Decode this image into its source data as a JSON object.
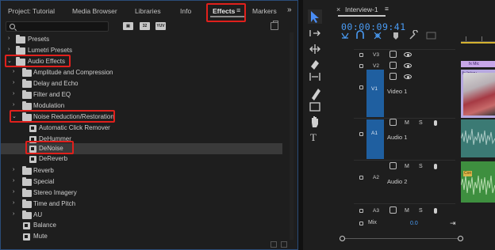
{
  "effects_panel": {
    "tabs": {
      "project": "Project: Tutorial",
      "media_browser": "Media Browser",
      "libraries": "Libraries",
      "info": "Info",
      "effects": "Effects",
      "markers": "Markers"
    },
    "menu_glyph": "≡",
    "overflow_glyph": "»",
    "search": {
      "placeholder": "",
      "value": ""
    },
    "badges": {
      "accelerated": "▣",
      "b32": "32",
      "yuv": "YUV"
    },
    "tree": {
      "presets": "Presets",
      "lumetri_presets": "Lumetri Presets",
      "audio_effects": "Audio Effects",
      "amplitude": "Amplitude and Compression",
      "delay": "Delay and Echo",
      "filter": "Filter and EQ",
      "modulation": "Modulation",
      "noise": "Noise Reduction/Restoration",
      "auto_click": "Automatic Click Remover",
      "dehummer": "DeHummer",
      "denoise": "DeNoise",
      "dereverb": "DeReverb",
      "reverb": "Reverb",
      "special": "Special",
      "stereo": "Stereo Imagery",
      "time_pitch": "Time and Pitch",
      "au": "AU",
      "balance": "Balance",
      "mute": "Mute"
    },
    "highlight_color": "#e0201c"
  },
  "timeline": {
    "sequence_tab": "Interview-1",
    "menu_glyph": "≡",
    "close_glyph": "×",
    "timecode": "00:00:09:41",
    "tracks": {
      "v3": "V3",
      "v2": "V2",
      "v1": "V1",
      "video1": "Video 1",
      "a1": "A1",
      "audio1": "Audio 1",
      "a2": "A2",
      "audio2": "Audio 2",
      "a3": "A3"
    },
    "controls": {
      "m": "M",
      "s": "S"
    },
    "mix_label": "Mix",
    "mix_value": "0.0",
    "clip_labels": {
      "top": "fx Mic",
      "video": "fx Interv",
      "audio": "Con"
    },
    "accent_color": "#4a9cf5"
  }
}
